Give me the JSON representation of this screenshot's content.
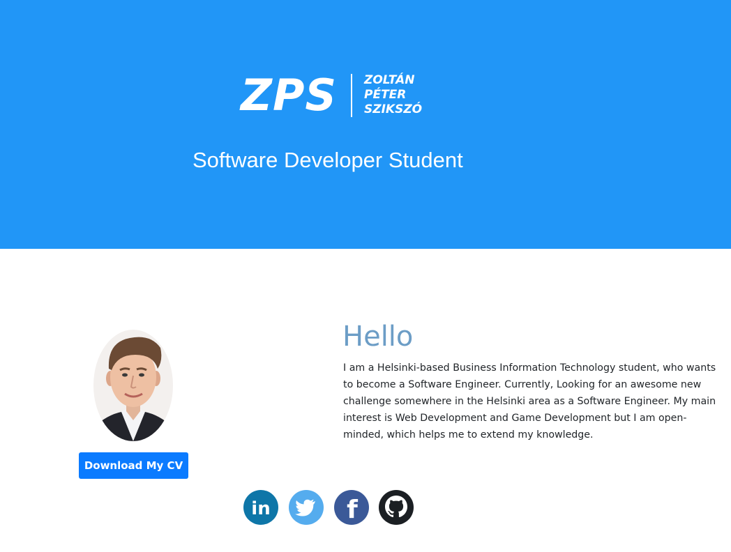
{
  "header": {
    "logo_mark": "ZPS",
    "logo_name": [
      "ZOLTÁN",
      "PÉTER",
      "SZIKSZÓ"
    ],
    "subtitle": "Software Developer Student",
    "background_color": "#2196f7"
  },
  "profile": {
    "avatar_icon": "profile-photo",
    "cv_button_label": "Download My CV",
    "cv_button_color": "#0b7bff"
  },
  "intro": {
    "heading": "Hello",
    "heading_color": "#6c9dc6",
    "body": "I am a Helsinki-based Business Information Technology student, who wants to become a Software Engineer. Currently, Looking for an awesome new challenge somewhere in the Helsinki area as a Software Engineer. My main interest is Web Development and Game Development but I am open-minded, which helps me to extend my knowledge."
  },
  "social": [
    {
      "icon": "linkedin-icon",
      "label": "in",
      "color": "#0e76a8"
    },
    {
      "icon": "twitter-icon",
      "color": "#55acee"
    },
    {
      "icon": "facebook-icon",
      "label": "f",
      "color": "#3b5998"
    },
    {
      "icon": "github-icon",
      "color": "#1b1f23"
    }
  ]
}
